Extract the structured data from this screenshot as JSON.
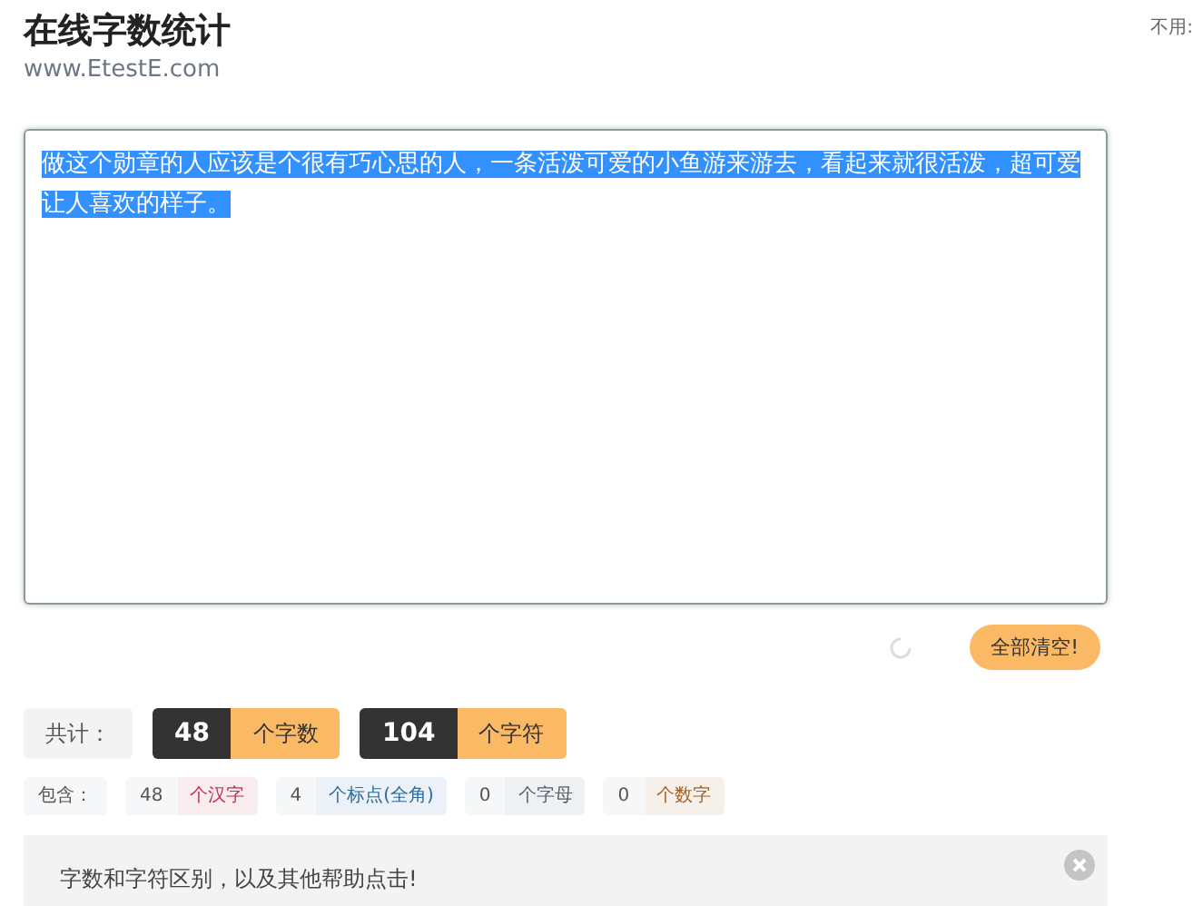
{
  "header": {
    "title": "在线字数统计",
    "subtitle": "www.EtestE.com",
    "side_note": "不用:"
  },
  "editor": {
    "value": "做这个勋章的人应该是个很有巧心思的人，一条活泼可爱的小鱼游来游去，看起来就很活泼，超可爱让人喜欢的样子。",
    "selected": true
  },
  "actions": {
    "loading": true,
    "clear_button": "全部清空!"
  },
  "totals": {
    "label": "共计：",
    "items": [
      {
        "value": "48",
        "unit": "个字数"
      },
      {
        "value": "104",
        "unit": "个字符"
      }
    ]
  },
  "breakdown": {
    "label": "包含：",
    "items": [
      {
        "value": "48",
        "unit": "个汉字",
        "color": "#c0304a"
      },
      {
        "value": "4",
        "unit": "个标点(全角)",
        "color": "#2b6c9e"
      },
      {
        "value": "0",
        "unit": "个字母",
        "color": "#556070"
      },
      {
        "value": "0",
        "unit": "个数字",
        "color": "#a0622a"
      }
    ]
  },
  "help": {
    "text": "字数和字符区别，以及其他帮助点击!"
  }
}
